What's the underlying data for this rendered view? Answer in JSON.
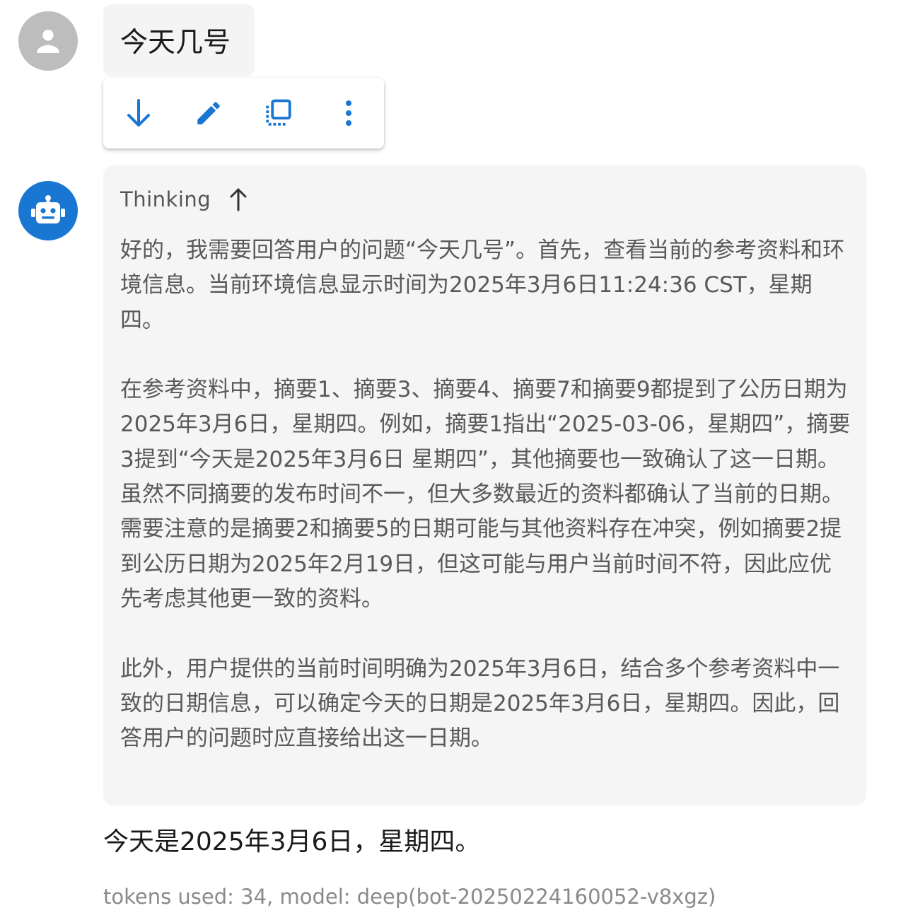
{
  "user_message": {
    "text": "今天几号"
  },
  "actions": {
    "download_icon": "arrow-down-icon",
    "edit_icon": "pencil-icon",
    "copy_icon": "copy-icon",
    "more_icon": "more-vertical-icon"
  },
  "thinking": {
    "label": "Thinking",
    "toggle_icon": "arrow-up-icon",
    "paragraphs": [
      "好的，我需要回答用户的问题“今天几号”。首先，查看当前的参考资料和环境信息。当前环境信息显示时间为2025年3月6日11:24:36 CST，星期四。",
      "在参考资料中，摘要1、摘要3、摘要4、摘要7和摘要9都提到了公历日期为2025年3月6日，星期四。例如，摘要1指出“2025-03-06，星期四”，摘要3提到“今天是2025年3月6日 星期四”，其他摘要也一致确认了这一日期。虽然不同摘要的发布时间不一，但大多数最近的资料都确认了当前的日期。需要注意的是摘要2和摘要5的日期可能与其他资料存在冲突，例如摘要2提到公历日期为2025年2月19日，但这可能与用户当前时间不符，因此应优先考虑其他更一致的资料。",
      "此外，用户提供的当前时间明确为2025年3月6日，结合多个参考资料中一致的日期信息，可以确定今天的日期是2025年3月6日，星期四。因此，回答用户的问题时应直接给出这一日期。"
    ]
  },
  "answer": {
    "text": "今天是2025年3月6日，星期四。"
  },
  "footer": {
    "text": "tokens used: 34, model: deep(bot-20250224160052-v8xgz)"
  },
  "colors": {
    "accent": "#1976d2",
    "user_avatar": "#bdbdbd",
    "card_background": "#f5f5f5"
  }
}
